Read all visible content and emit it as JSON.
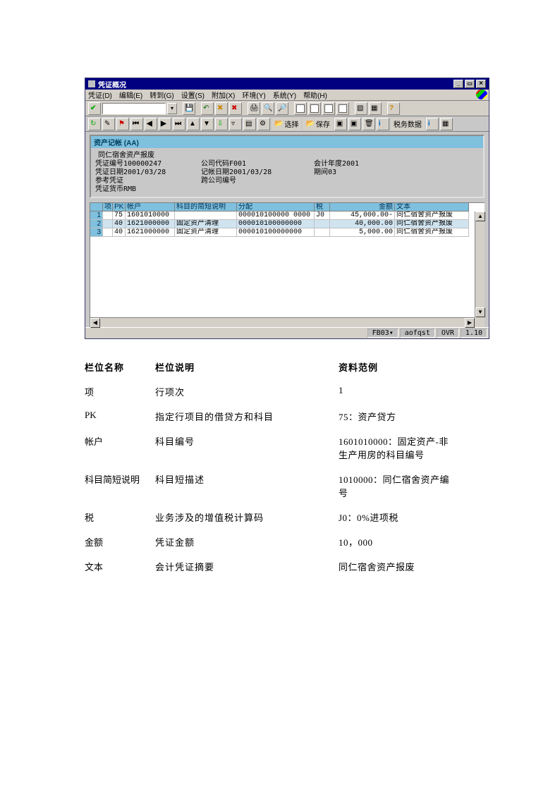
{
  "window": {
    "title": "凭证概况"
  },
  "menubar": {
    "items": [
      "凭证(D)",
      "编辑(E)",
      "转到(G)",
      "设置(S)",
      "附加(X)",
      "环境(Y)",
      "系统(Y)",
      "帮助(H)"
    ]
  },
  "toolbar2": {
    "select_btn": "选择",
    "save_btn": "保存",
    "tax_btn": "税务数据"
  },
  "header": {
    "section_title": "资产记帐 (AA)",
    "doc_title": "同仁宿舍资产报废",
    "rows": [
      {
        "l1": "凭证编号",
        "v1": "100000247",
        "l2": "公司代码",
        "v2": "F001",
        "l3": "会计年度",
        "v3": "2001"
      },
      {
        "l1": "凭证日期",
        "v1": "2001/03/28",
        "l2": "记帐日期",
        "v2": "2001/03/28",
        "l3": "期间",
        "v3": "03"
      },
      {
        "l1": "参考凭证",
        "v1": "",
        "l2": "跨公司编号",
        "v2": "",
        "l3": "",
        "v3": ""
      },
      {
        "l1": "凭证货币",
        "v1": "RMB",
        "l2": "",
        "v2": "",
        "l3": "",
        "v3": ""
      }
    ]
  },
  "grid": {
    "columns": [
      "项",
      "PK",
      "帐户",
      "科目的简短说明",
      "分配",
      "税",
      "金额",
      "文本"
    ],
    "rows": [
      {
        "n": "1",
        "pk": "75",
        "acct": "1601010000",
        "desc": "",
        "alloc": "000010100000 0000",
        "tax": "J0",
        "amt": "45,000.00-",
        "text": "同仁宿舍资产报废"
      },
      {
        "n": "2",
        "pk": "40",
        "acct": "1621000000",
        "desc": "固定资产清理",
        "alloc": "000010100000000",
        "tax": "",
        "amt": "40,000.00",
        "text": "同仁宿舍资产报废"
      },
      {
        "n": "3",
        "pk": "40",
        "acct": "1621000000",
        "desc": "固定资产清理",
        "alloc": "000010100000000",
        "tax": "",
        "amt": "5,000.00",
        "text": "同仁宿舍资产报废"
      }
    ]
  },
  "statusbar": {
    "tcode": "FB03",
    "user": "aofqst",
    "mode": "OVR",
    "version": "1.10"
  },
  "desc": {
    "head": {
      "c1": "栏位名称",
      "c2": "栏位说明",
      "c3": "资料范例"
    },
    "rows": [
      {
        "c1": "项",
        "c2": "行项次",
        "c3": "1"
      },
      {
        "c1": "PK",
        "c2": "指定行项目的借贷方和科目",
        "c3": "75：资产贷方"
      },
      {
        "c1": "帐户",
        "c2": "科目编号",
        "c3": "1601010000：固定资产-非生产用房的科目编号"
      },
      {
        "c1": "科目简短说明",
        "c2": "科目短描述",
        "c3": "1010000：同仁宿舍资产编号"
      },
      {
        "c1": "税",
        "c2": "业务涉及的增值税计算码",
        "c3": "J0：0%进项税"
      },
      {
        "c1": "金额",
        "c2": "凭证金额",
        "c3": "10，000"
      },
      {
        "c1": "文本",
        "c2": "会计凭证摘要",
        "c3": "同仁宿舍资产报废"
      }
    ]
  }
}
